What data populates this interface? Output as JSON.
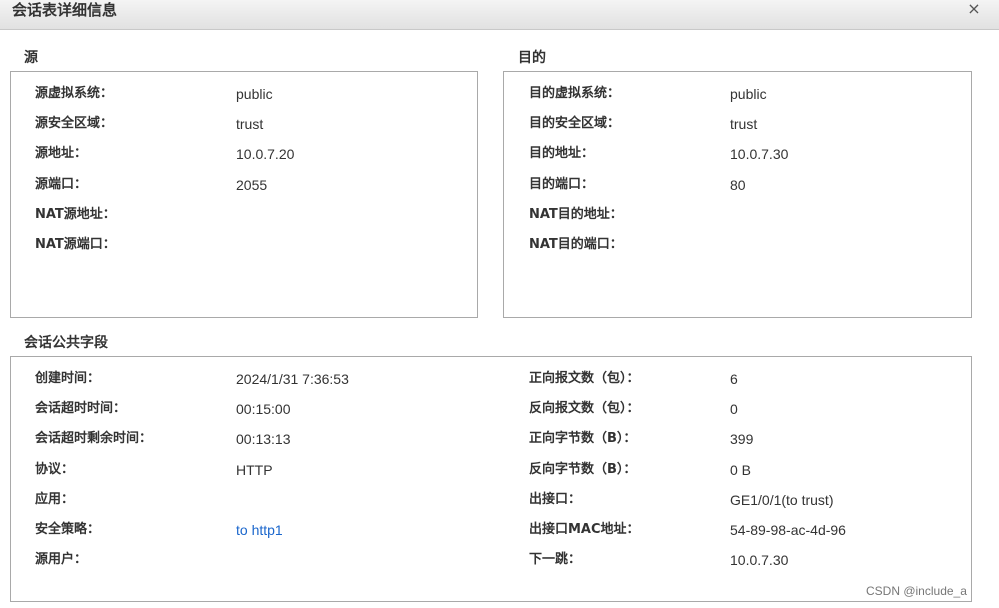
{
  "dialog": {
    "title": "会话表详细信息",
    "close_label": "×"
  },
  "source": {
    "heading": "源",
    "rows": [
      {
        "label": "源虚拟系统：",
        "value": "public"
      },
      {
        "label": "源安全区域：",
        "value": "trust"
      },
      {
        "label": "源地址：",
        "value": "10.0.7.20"
      },
      {
        "label": "源端口：",
        "value": "2055"
      },
      {
        "label": "NAT源地址：",
        "value": ""
      },
      {
        "label": "NAT源端口：",
        "value": ""
      }
    ]
  },
  "destination": {
    "heading": "目的",
    "rows": [
      {
        "label": "目的虚拟系统：",
        "value": "public"
      },
      {
        "label": "目的安全区域：",
        "value": "trust"
      },
      {
        "label": "目的地址：",
        "value": "10.0.7.30"
      },
      {
        "label": "目的端口：",
        "value": "80"
      },
      {
        "label": "NAT目的地址：",
        "value": ""
      },
      {
        "label": "NAT目的端口：",
        "value": ""
      }
    ]
  },
  "common": {
    "heading": "会话公共字段",
    "left_rows": [
      {
        "label": "创建时间：",
        "value": "2024/1/31 7:36:53"
      },
      {
        "label": "会话超时时间：",
        "value": "00:15:00"
      },
      {
        "label": "会话超时剩余时间：",
        "value": "00:13:13"
      },
      {
        "label": "协议：",
        "value": "HTTP"
      },
      {
        "label": "应用：",
        "value": ""
      },
      {
        "label": "安全策略：",
        "value": "to http1"
      },
      {
        "label": "源用户：",
        "value": ""
      }
    ],
    "right_rows": [
      {
        "label": "正向报文数（包）：",
        "value": "6"
      },
      {
        "label": "反向报文数（包）：",
        "value": "0"
      },
      {
        "label": "正向字节数（B）：",
        "value": "399"
      },
      {
        "label": "反向字节数（B）：",
        "value": "0 B"
      },
      {
        "label": "出接口：",
        "value": "GE1/0/1(to trust)"
      },
      {
        "label": "出接口MAC地址：",
        "value": "54-89-98-ac-4d-96"
      },
      {
        "label": "下一跳：",
        "value": "10.0.7.30"
      }
    ]
  },
  "watermark": "CSDN @include_a",
  "colors": {
    "link": "#1a66cc",
    "border": "#a9a9a9",
    "titlebar": "#e1e1e1"
  }
}
